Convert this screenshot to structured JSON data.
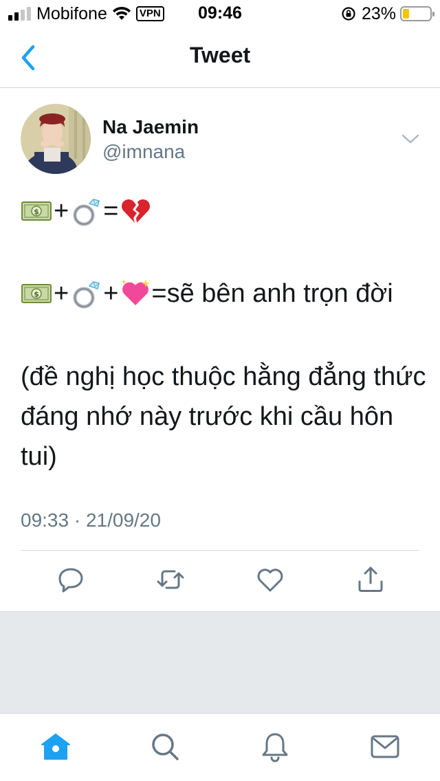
{
  "status_bar": {
    "carrier": "Mobifone",
    "vpn_label": "VPN",
    "time": "09:46",
    "battery_percent": "23%",
    "battery_level": 0.23,
    "battery_color": "#f5c400"
  },
  "nav": {
    "title": "Tweet",
    "back_icon": "chevron-left-icon",
    "accent_color": "#1da1f2"
  },
  "tweet": {
    "author_name": "Na Jaemin",
    "author_handle": "@imnana",
    "line1": {
      "emojis": [
        "money-emoji",
        "ring-emoji",
        "broken-heart-emoji"
      ],
      "plus": "+",
      "equals": "="
    },
    "line2": {
      "emojis": [
        "money-emoji",
        "ring-emoji",
        "sparkling-heart-emoji"
      ],
      "plus": "+",
      "equals_text": "=sẽ bên anh trọn đời"
    },
    "note": "(đề nghị học thuộc hằng đẳng thức đáng nhớ này trước khi cầu hôn tui)",
    "timestamp": "09:33 · 21/09/20"
  },
  "actions": [
    "reply-icon",
    "retweet-icon",
    "like-icon",
    "share-icon"
  ],
  "tab_bar": [
    "home-icon",
    "search-icon",
    "notifications-icon",
    "messages-icon"
  ]
}
